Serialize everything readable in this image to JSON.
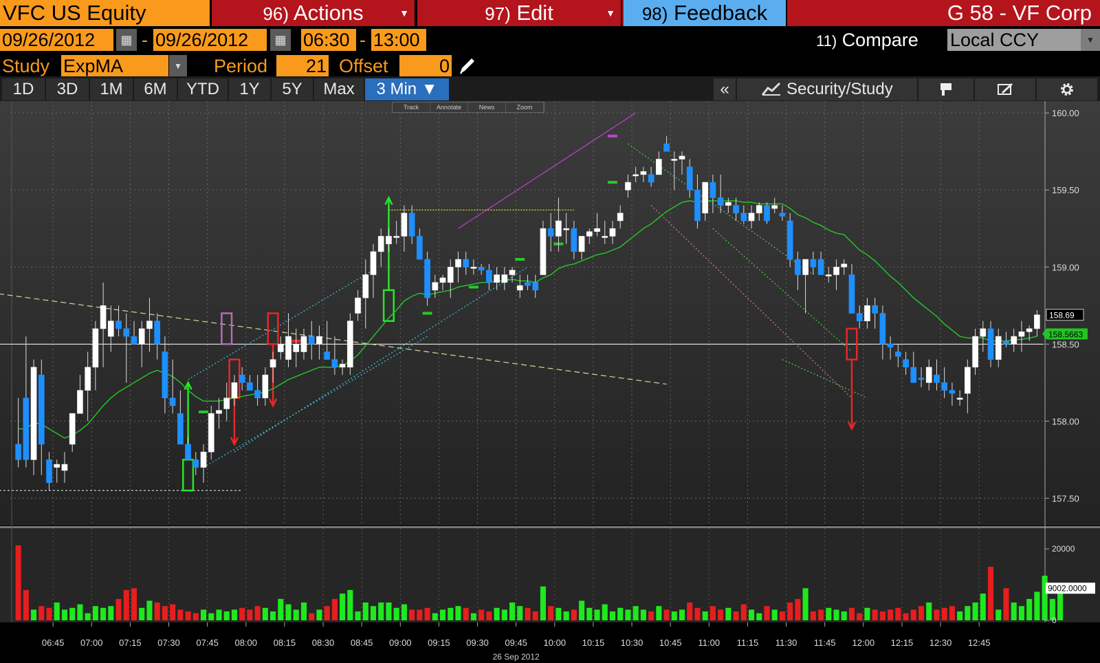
{
  "header": {
    "ticker": "VFC US Equity",
    "actions": {
      "num": "96)",
      "label": "Actions"
    },
    "edit": {
      "num": "97)",
      "label": "Edit"
    },
    "feedback": {
      "num": "98)",
      "label": "Feedback"
    },
    "title": "G 58 - VF Corp"
  },
  "range": {
    "start_date": "09/26/2012",
    "end_date": "09/26/2012",
    "start_time": "06:30",
    "end_time": "13:00",
    "sep": "-",
    "compare_num": "11)",
    "compare_label": "Compare",
    "currency": "Local CCY"
  },
  "study": {
    "label": "Study",
    "value": "ExpMA",
    "period_label": "Period",
    "period_value": "21",
    "offset_label": "Offset",
    "offset_value": "0"
  },
  "toolbar": {
    "ranges": [
      "1D",
      "3D",
      "1M",
      "6M",
      "YTD",
      "1Y",
      "5Y",
      "Max"
    ],
    "interval": "3 Min ▼",
    "collapse": "«",
    "security_study": "Security/Study"
  },
  "mini_tools": [
    "Track",
    "Annotate",
    "News",
    "Zoom"
  ],
  "colors": {
    "orange": "#f99a1c",
    "red_bar": "#b4141c",
    "blue_candle": "#1e8fff",
    "ema": "#28c828",
    "up_vol": "#1ee81e",
    "down_vol": "#e61e1e"
  },
  "chart_data": {
    "type": "candlestick",
    "date_label": "26 Sep 2012",
    "x_ticks": [
      "06:45",
      "07:00",
      "07:15",
      "07:30",
      "07:45",
      "08:00",
      "08:15",
      "08:30",
      "08:45",
      "09:00",
      "09:15",
      "09:30",
      "09:45",
      "10:00",
      "10:15",
      "10:30",
      "10:45",
      "11:00",
      "11:15",
      "11:30",
      "11:45",
      "12:00",
      "12:15",
      "12:30",
      "12:45"
    ],
    "y_ticks": [
      "160.00",
      "159.50",
      "159.00",
      "158.50",
      "158.00",
      "157.50"
    ],
    "price_ylim": [
      157.35,
      160.05
    ],
    "last_price": "158.69",
    "ema_value": "158.5663",
    "study": "ExpMA 21",
    "candles": [
      [
        157.85,
        158.15,
        157.7,
        157.75
      ],
      [
        158.15,
        158.55,
        157.7,
        157.75
      ],
      [
        157.75,
        158.4,
        157.65,
        158.35
      ],
      [
        158.3,
        158.4,
        157.65,
        157.85
      ],
      [
        157.75,
        157.8,
        157.55,
        157.6
      ],
      [
        157.7,
        157.75,
        157.6,
        157.72
      ],
      [
        157.68,
        157.8,
        157.6,
        157.72
      ],
      [
        157.85,
        158.05,
        157.8,
        158.05
      ],
      [
        158.05,
        158.3,
        158.05,
        158.2
      ],
      [
        158.2,
        158.45,
        158.0,
        158.35
      ],
      [
        158.35,
        158.65,
        158.2,
        158.6
      ],
      [
        158.6,
        158.9,
        158.35,
        158.75
      ],
      [
        158.55,
        158.75,
        158.45,
        158.65
      ],
      [
        158.65,
        158.75,
        158.55,
        158.6
      ],
      [
        158.6,
        158.7,
        158.25,
        158.55
      ],
      [
        158.55,
        158.65,
        158.5,
        158.5
      ],
      [
        158.5,
        158.65,
        158.35,
        158.6
      ],
      [
        158.6,
        158.8,
        158.45,
        158.65
      ],
      [
        158.65,
        158.7,
        158.4,
        158.5
      ],
      [
        158.45,
        158.55,
        158.05,
        158.15
      ],
      [
        158.15,
        158.4,
        158.05,
        158.1
      ],
      [
        158.05,
        158.2,
        157.85,
        157.85
      ],
      [
        157.85,
        157.9,
        157.75,
        157.75
      ],
      [
        157.75,
        157.8,
        157.65,
        157.7
      ],
      [
        157.7,
        157.85,
        157.6,
        157.8
      ],
      [
        157.8,
        158.1,
        157.75,
        158.05
      ],
      [
        158.05,
        158.15,
        157.95,
        158.07
      ],
      [
        158.08,
        158.25,
        158.0,
        158.15
      ],
      [
        158.15,
        158.3,
        158.1,
        158.25
      ],
      [
        158.3,
        158.35,
        158.2,
        158.25
      ],
      [
        158.25,
        158.3,
        158.2,
        158.2
      ],
      [
        158.2,
        158.3,
        158.1,
        158.15
      ],
      [
        158.15,
        158.35,
        158.1,
        158.3
      ],
      [
        158.35,
        158.45,
        158.25,
        158.4
      ],
      [
        158.45,
        158.55,
        158.4,
        158.5
      ],
      [
        158.4,
        158.7,
        158.35,
        158.55
      ],
      [
        158.45,
        158.6,
        158.35,
        158.5
      ],
      [
        158.45,
        158.6,
        158.4,
        158.55
      ],
      [
        158.55,
        158.65,
        158.4,
        158.5
      ],
      [
        158.5,
        158.62,
        158.4,
        158.55
      ],
      [
        158.45,
        158.65,
        158.4,
        158.4
      ],
      [
        158.4,
        158.55,
        158.3,
        158.35
      ],
      [
        158.35,
        158.4,
        158.3,
        158.37
      ],
      [
        158.35,
        158.7,
        158.3,
        158.65
      ],
      [
        158.7,
        158.85,
        158.65,
        158.8
      ],
      [
        158.8,
        159.05,
        158.6,
        158.95
      ],
      [
        158.95,
        159.15,
        158.8,
        159.1
      ],
      [
        159.1,
        159.25,
        159.0,
        159.2
      ],
      [
        159.15,
        159.25,
        159.1,
        159.2
      ],
      [
        159.2,
        159.3,
        159.15,
        159.2
      ],
      [
        159.2,
        159.4,
        159.1,
        159.35
      ],
      [
        159.35,
        159.4,
        159.15,
        159.2
      ],
      [
        159.2,
        159.25,
        159.05,
        159.05
      ],
      [
        159.05,
        159.1,
        158.75,
        158.8
      ],
      [
        158.85,
        158.95,
        158.8,
        158.9
      ],
      [
        158.9,
        158.95,
        158.85,
        158.93
      ],
      [
        158.9,
        159.05,
        158.8,
        159.0
      ],
      [
        159.0,
        159.1,
        158.9,
        159.05
      ],
      [
        159.05,
        159.1,
        158.95,
        159.0
      ],
      [
        159.0,
        159.05,
        158.95,
        159.0
      ],
      [
        159.0,
        159.02,
        158.95,
        158.98
      ],
      [
        158.98,
        159.02,
        158.85,
        158.9
      ],
      [
        158.9,
        159.0,
        158.85,
        158.95
      ],
      [
        158.9,
        159.0,
        158.85,
        158.95
      ],
      [
        158.95,
        159.0,
        158.9,
        158.98
      ],
      [
        158.85,
        158.95,
        158.8,
        158.88
      ],
      [
        158.9,
        158.95,
        158.85,
        158.88
      ],
      [
        158.9,
        158.95,
        158.8,
        158.85
      ],
      [
        158.95,
        159.3,
        158.95,
        159.25
      ],
      [
        159.25,
        159.35,
        159.1,
        159.2
      ],
      [
        159.2,
        159.45,
        159.1,
        159.3
      ],
      [
        159.25,
        159.35,
        159.15,
        159.25
      ],
      [
        159.25,
        159.3,
        159.05,
        159.1
      ],
      [
        159.1,
        159.2,
        159.05,
        159.2
      ],
      [
        159.2,
        159.25,
        159.15,
        159.23
      ],
      [
        159.23,
        159.35,
        159.2,
        159.25
      ],
      [
        159.2,
        159.3,
        159.15,
        159.2
      ],
      [
        159.2,
        159.3,
        159.15,
        159.25
      ],
      [
        159.3,
        159.4,
        159.25,
        159.35
      ],
      [
        159.5,
        159.6,
        159.45,
        159.55
      ],
      [
        159.6,
        159.65,
        159.55,
        159.6
      ],
      [
        159.6,
        159.65,
        159.55,
        159.62
      ],
      [
        159.6,
        159.65,
        159.52,
        159.55
      ],
      [
        159.6,
        159.75,
        159.6,
        159.7
      ],
      [
        159.8,
        159.85,
        159.75,
        159.75
      ],
      [
        159.7,
        159.75,
        159.5,
        159.7
      ],
      [
        159.7,
        159.75,
        159.6,
        159.72
      ],
      [
        159.65,
        159.7,
        159.45,
        159.5
      ],
      [
        159.5,
        159.6,
        159.25,
        159.3
      ],
      [
        159.35,
        159.55,
        159.3,
        159.55
      ],
      [
        159.55,
        159.6,
        159.35,
        159.45
      ],
      [
        159.45,
        159.6,
        159.35,
        159.4
      ],
      [
        159.4,
        159.45,
        159.35,
        159.42
      ],
      [
        159.4,
        159.45,
        159.3,
        159.35
      ],
      [
        159.35,
        159.4,
        159.28,
        159.3
      ],
      [
        159.3,
        159.4,
        159.25,
        159.35
      ],
      [
        159.35,
        159.42,
        159.3,
        159.4
      ],
      [
        159.4,
        159.42,
        159.28,
        159.3
      ],
      [
        159.38,
        159.45,
        159.35,
        159.4
      ],
      [
        159.35,
        159.4,
        159.3,
        159.33
      ],
      [
        159.3,
        159.35,
        159.0,
        159.05
      ],
      [
        159.05,
        159.1,
        158.85,
        158.95
      ],
      [
        158.95,
        159.05,
        158.7,
        159.05
      ],
      [
        159.05,
        159.1,
        158.95,
        159.0
      ],
      [
        159.05,
        159.1,
        158.95,
        158.95
      ],
      [
        158.95,
        159.0,
        158.9,
        158.95
      ],
      [
        158.95,
        159.05,
        158.85,
        159.0
      ],
      [
        159.0,
        159.05,
        158.95,
        159.02
      ],
      [
        158.95,
        159.02,
        158.7,
        158.7
      ],
      [
        158.7,
        158.75,
        158.6,
        158.65
      ],
      [
        158.65,
        158.8,
        158.6,
        158.75
      ],
      [
        158.75,
        158.8,
        158.6,
        158.7
      ],
      [
        158.7,
        158.75,
        158.4,
        158.5
      ],
      [
        158.5,
        158.55,
        158.4,
        158.48
      ],
      [
        158.45,
        158.5,
        158.35,
        158.42
      ],
      [
        158.4,
        158.45,
        158.3,
        158.35
      ],
      [
        158.35,
        158.45,
        158.25,
        158.25
      ],
      [
        158.28,
        158.35,
        158.22,
        158.27
      ],
      [
        158.25,
        158.4,
        158.2,
        158.35
      ],
      [
        158.3,
        158.4,
        158.2,
        158.25
      ],
      [
        158.25,
        158.35,
        158.15,
        158.2
      ],
      [
        158.2,
        158.25,
        158.1,
        158.18
      ],
      [
        158.15,
        158.2,
        158.1,
        158.15
      ],
      [
        158.18,
        158.4,
        158.05,
        158.35
      ],
      [
        158.35,
        158.6,
        158.3,
        158.55
      ],
      [
        158.55,
        158.65,
        158.45,
        158.6
      ],
      [
        158.6,
        158.65,
        158.35,
        158.4
      ],
      [
        158.4,
        158.6,
        158.35,
        158.55
      ],
      [
        158.52,
        158.58,
        158.48,
        158.5
      ],
      [
        158.5,
        158.6,
        158.45,
        158.55
      ],
      [
        158.55,
        158.65,
        158.45,
        158.58
      ],
      [
        158.58,
        158.62,
        158.52,
        158.6
      ],
      [
        158.6,
        158.72,
        158.55,
        158.69
      ]
    ],
    "ema": [
      157.95,
      157.95,
      157.99,
      157.98,
      157.95,
      157.92,
      157.89,
      157.91,
      157.94,
      157.98,
      158.04,
      158.1,
      158.15,
      158.19,
      158.22,
      158.25,
      158.28,
      158.31,
      158.33,
      158.31,
      158.29,
      158.25,
      158.2,
      158.16,
      158.13,
      158.13,
      158.13,
      158.14,
      158.15,
      158.16,
      158.17,
      158.18,
      158.19,
      158.21,
      158.24,
      158.27,
      158.29,
      158.31,
      158.33,
      158.35,
      158.35,
      158.35,
      158.36,
      158.39,
      158.43,
      158.49,
      158.55,
      158.61,
      158.67,
      158.72,
      158.78,
      158.81,
      158.83,
      158.82,
      158.83,
      158.84,
      158.85,
      158.87,
      158.88,
      158.89,
      158.9,
      158.9,
      158.91,
      158.91,
      158.92,
      158.91,
      158.91,
      158.9,
      158.93,
      158.95,
      158.99,
      159.01,
      159.02,
      159.04,
      159.06,
      159.08,
      159.09,
      159.11,
      159.13,
      159.17,
      159.21,
      159.25,
      159.28,
      159.32,
      159.36,
      159.39,
      159.42,
      159.43,
      159.42,
      159.43,
      159.43,
      159.43,
      159.43,
      159.43,
      159.42,
      159.42,
      159.41,
      159.41,
      159.41,
      159.41,
      159.38,
      159.34,
      159.32,
      159.29,
      159.27,
      159.24,
      159.22,
      159.21,
      159.16,
      159.11,
      159.08,
      159.04,
      158.99,
      158.94,
      158.9,
      158.85,
      158.8,
      158.76,
      158.72,
      158.68,
      158.63,
      158.59,
      158.55,
      158.54,
      158.54,
      158.54,
      158.52,
      158.52,
      158.52,
      158.53,
      158.53,
      158.54,
      158.55
    ],
    "volume": {
      "ylim": [
        0,
        26000
      ],
      "y_ticks": [
        "20000",
        "9002.0000",
        "0"
      ],
      "values": [
        21000,
        8500,
        3000,
        4000,
        3500,
        5000,
        3000,
        3500,
        4500,
        2000,
        4000,
        3500,
        4000,
        6000,
        8500,
        9000,
        3500,
        5500,
        5000,
        4000,
        4500,
        3000,
        2500,
        2000,
        3000,
        2000,
        3000,
        2500,
        3000,
        3500,
        3000,
        4000,
        3500,
        2500,
        6000,
        4500,
        3000,
        5000,
        2000,
        3000,
        4000,
        6000,
        7500,
        8500,
        2500,
        5000,
        4000,
        5000,
        5000,
        3500,
        4500,
        3000,
        3000,
        3500,
        2000,
        3000,
        3500,
        4000,
        3500,
        2000,
        3000,
        2500,
        3500,
        3000,
        5000,
        4000,
        3500,
        2500,
        9500,
        4000,
        3500,
        2500,
        3000,
        5500,
        3500,
        3000,
        4500,
        2500,
        3500,
        3000,
        4000,
        3000,
        2500,
        4000,
        3000,
        2500,
        3000,
        5000,
        3500,
        2500,
        4000,
        3000,
        3500,
        2500,
        4500,
        3000,
        2000,
        4000,
        3000,
        2500,
        5000,
        6000,
        9000,
        2500,
        3000,
        3500,
        3000,
        2500,
        3500,
        2000,
        3500,
        3000,
        2500,
        3000,
        3500,
        2000,
        3000,
        4000,
        5000,
        3000,
        3500,
        4000,
        2500,
        4000,
        5000,
        7500,
        15000,
        3000,
        9000,
        5000,
        4000,
        6000,
        8000,
        12500,
        6000,
        9500
      ]
    }
  }
}
